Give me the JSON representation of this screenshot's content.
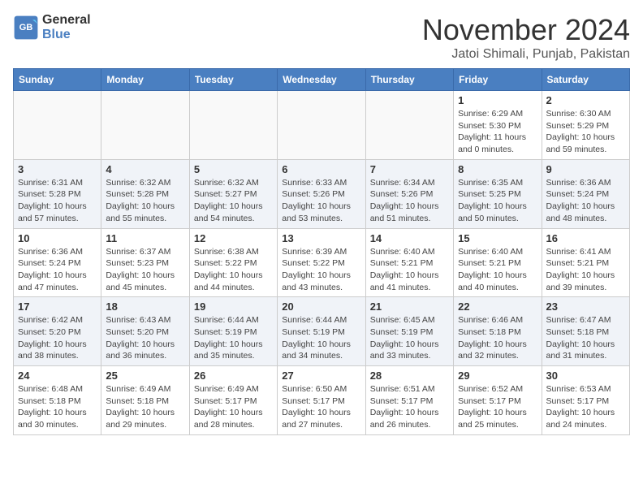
{
  "logo": {
    "line1": "General",
    "line2": "Blue"
  },
  "title": "November 2024",
  "location": "Jatoi Shimali, Punjab, Pakistan",
  "headers": [
    "Sunday",
    "Monday",
    "Tuesday",
    "Wednesday",
    "Thursday",
    "Friday",
    "Saturday"
  ],
  "weeks": [
    [
      {
        "day": "",
        "info": ""
      },
      {
        "day": "",
        "info": ""
      },
      {
        "day": "",
        "info": ""
      },
      {
        "day": "",
        "info": ""
      },
      {
        "day": "",
        "info": ""
      },
      {
        "day": "1",
        "info": "Sunrise: 6:29 AM\nSunset: 5:30 PM\nDaylight: 11 hours and 0 minutes."
      },
      {
        "day": "2",
        "info": "Sunrise: 6:30 AM\nSunset: 5:29 PM\nDaylight: 10 hours and 59 minutes."
      }
    ],
    [
      {
        "day": "3",
        "info": "Sunrise: 6:31 AM\nSunset: 5:28 PM\nDaylight: 10 hours and 57 minutes."
      },
      {
        "day": "4",
        "info": "Sunrise: 6:32 AM\nSunset: 5:28 PM\nDaylight: 10 hours and 55 minutes."
      },
      {
        "day": "5",
        "info": "Sunrise: 6:32 AM\nSunset: 5:27 PM\nDaylight: 10 hours and 54 minutes."
      },
      {
        "day": "6",
        "info": "Sunrise: 6:33 AM\nSunset: 5:26 PM\nDaylight: 10 hours and 53 minutes."
      },
      {
        "day": "7",
        "info": "Sunrise: 6:34 AM\nSunset: 5:26 PM\nDaylight: 10 hours and 51 minutes."
      },
      {
        "day": "8",
        "info": "Sunrise: 6:35 AM\nSunset: 5:25 PM\nDaylight: 10 hours and 50 minutes."
      },
      {
        "day": "9",
        "info": "Sunrise: 6:36 AM\nSunset: 5:24 PM\nDaylight: 10 hours and 48 minutes."
      }
    ],
    [
      {
        "day": "10",
        "info": "Sunrise: 6:36 AM\nSunset: 5:24 PM\nDaylight: 10 hours and 47 minutes."
      },
      {
        "day": "11",
        "info": "Sunrise: 6:37 AM\nSunset: 5:23 PM\nDaylight: 10 hours and 45 minutes."
      },
      {
        "day": "12",
        "info": "Sunrise: 6:38 AM\nSunset: 5:22 PM\nDaylight: 10 hours and 44 minutes."
      },
      {
        "day": "13",
        "info": "Sunrise: 6:39 AM\nSunset: 5:22 PM\nDaylight: 10 hours and 43 minutes."
      },
      {
        "day": "14",
        "info": "Sunrise: 6:40 AM\nSunset: 5:21 PM\nDaylight: 10 hours and 41 minutes."
      },
      {
        "day": "15",
        "info": "Sunrise: 6:40 AM\nSunset: 5:21 PM\nDaylight: 10 hours and 40 minutes."
      },
      {
        "day": "16",
        "info": "Sunrise: 6:41 AM\nSunset: 5:21 PM\nDaylight: 10 hours and 39 minutes."
      }
    ],
    [
      {
        "day": "17",
        "info": "Sunrise: 6:42 AM\nSunset: 5:20 PM\nDaylight: 10 hours and 38 minutes."
      },
      {
        "day": "18",
        "info": "Sunrise: 6:43 AM\nSunset: 5:20 PM\nDaylight: 10 hours and 36 minutes."
      },
      {
        "day": "19",
        "info": "Sunrise: 6:44 AM\nSunset: 5:19 PM\nDaylight: 10 hours and 35 minutes."
      },
      {
        "day": "20",
        "info": "Sunrise: 6:44 AM\nSunset: 5:19 PM\nDaylight: 10 hours and 34 minutes."
      },
      {
        "day": "21",
        "info": "Sunrise: 6:45 AM\nSunset: 5:19 PM\nDaylight: 10 hours and 33 minutes."
      },
      {
        "day": "22",
        "info": "Sunrise: 6:46 AM\nSunset: 5:18 PM\nDaylight: 10 hours and 32 minutes."
      },
      {
        "day": "23",
        "info": "Sunrise: 6:47 AM\nSunset: 5:18 PM\nDaylight: 10 hours and 31 minutes."
      }
    ],
    [
      {
        "day": "24",
        "info": "Sunrise: 6:48 AM\nSunset: 5:18 PM\nDaylight: 10 hours and 30 minutes."
      },
      {
        "day": "25",
        "info": "Sunrise: 6:49 AM\nSunset: 5:18 PM\nDaylight: 10 hours and 29 minutes."
      },
      {
        "day": "26",
        "info": "Sunrise: 6:49 AM\nSunset: 5:17 PM\nDaylight: 10 hours and 28 minutes."
      },
      {
        "day": "27",
        "info": "Sunrise: 6:50 AM\nSunset: 5:17 PM\nDaylight: 10 hours and 27 minutes."
      },
      {
        "day": "28",
        "info": "Sunrise: 6:51 AM\nSunset: 5:17 PM\nDaylight: 10 hours and 26 minutes."
      },
      {
        "day": "29",
        "info": "Sunrise: 6:52 AM\nSunset: 5:17 PM\nDaylight: 10 hours and 25 minutes."
      },
      {
        "day": "30",
        "info": "Sunrise: 6:53 AM\nSunset: 5:17 PM\nDaylight: 10 hours and 24 minutes."
      }
    ]
  ]
}
